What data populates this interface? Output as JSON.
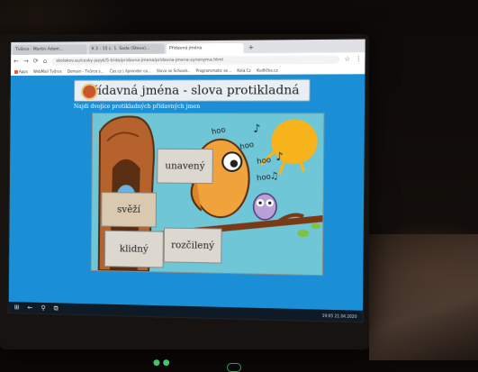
{
  "browser": {
    "tabs": [
      {
        "label": "Tvůrce - Martin Adam..."
      },
      {
        "label": "K 2 - 15 c. 1. Sada (Steve)..."
      },
      {
        "label": "Přídavná jména"
      }
    ],
    "new_tab": "+",
    "url": "skolakov.eu/cesky-jazyk/5-trida/pridavna-jmena/pridavna-jmena-synonyma.html",
    "bookmarks": [
      "Apps",
      "WebMail Tvůrce",
      "Domain - Tvůrce s...",
      "Čas.cz | Aprender co...",
      "Slovo se Schools..",
      "Programmatic se...",
      "Kola.Cz",
      "Kudlička.cz"
    ]
  },
  "page": {
    "title": "Přídavná jména - slova protikladná",
    "instruction": "Najdi dvojice protikladných přídavných jmen"
  },
  "game": {
    "cards": [
      {
        "id": "unaveny",
        "label": "unavený"
      },
      {
        "id": "svezi",
        "label": "svěží"
      },
      {
        "id": "klidny",
        "label": "klidný"
      },
      {
        "id": "rozcileny",
        "label": "rozčilený"
      }
    ],
    "scene_text": [
      "hoo",
      "hoo",
      "hoo",
      "hoo"
    ]
  },
  "taskbar": {
    "time": "19:05",
    "date": "21.04.2020"
  },
  "colors": {
    "page_bg": "#1a8fd6",
    "card_bg": "#dcd7cf",
    "sun": "#f7b31c",
    "owl": "#f0a33a"
  }
}
